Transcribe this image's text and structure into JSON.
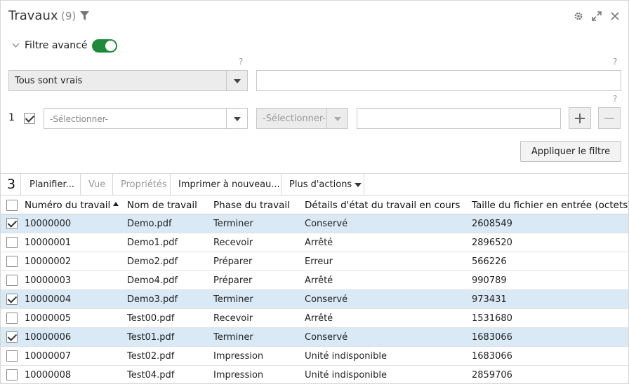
{
  "header": {
    "title": "Travaux",
    "count": "(9)"
  },
  "filter": {
    "advanced_label": "Filtre avancé",
    "advanced_enabled": true,
    "help": "?",
    "logic_select": "Tous sont vrais",
    "logic_value": "",
    "condition": {
      "row_number": "1",
      "checked": true,
      "field_placeholder": "-Sélectionner-",
      "operator_placeholder": "-Sélectionner-",
      "value": ""
    },
    "apply_label": "Appliquer le filtre"
  },
  "toolbar": {
    "selected_count": "3",
    "buttons": [
      {
        "label": "Planifier...",
        "enabled": true
      },
      {
        "label": "Vue",
        "enabled": false
      },
      {
        "label": "Propriétés",
        "enabled": false
      },
      {
        "label": "Imprimer à nouveau...",
        "enabled": true
      },
      {
        "label": "Plus d'actions",
        "enabled": true
      }
    ]
  },
  "table": {
    "columns": [
      "Numéro du travail",
      "Nom de travail",
      "Phase du travail",
      "Détails d'état du travail en cours",
      "Taille du fichier en entrée (octets)"
    ],
    "sort_column": 0,
    "rows": [
      {
        "selected": true,
        "cells": [
          "10000000",
          "Demo.pdf",
          "Terminer",
          "Conservé",
          "2608549"
        ]
      },
      {
        "selected": false,
        "cells": [
          "10000001",
          "Demo1.pdf",
          "Recevoir",
          "Arrêté",
          "2896520"
        ]
      },
      {
        "selected": false,
        "cells": [
          "10000002",
          "Demo2.pdf",
          "Préparer",
          "Erreur",
          "566226"
        ]
      },
      {
        "selected": false,
        "cells": [
          "10000003",
          "Demo4.pdf",
          "Préparer",
          "Arrêté",
          "990789"
        ]
      },
      {
        "selected": true,
        "cells": [
          "10000004",
          "Demo3.pdf",
          "Terminer",
          "Conservé",
          "973431"
        ]
      },
      {
        "selected": false,
        "cells": [
          "10000005",
          "Test00.pdf",
          "Recevoir",
          "Arrêté",
          "1531680"
        ]
      },
      {
        "selected": true,
        "cells": [
          "10000006",
          "Test01.pdf",
          "Terminer",
          "Conservé",
          "1683066"
        ]
      },
      {
        "selected": false,
        "cells": [
          "10000007",
          "Test02.pdf",
          "Impression",
          "Unité indisponible",
          "1683066"
        ]
      },
      {
        "selected": false,
        "cells": [
          "10000008",
          "Test04.pdf",
          "Impression",
          "Unité indisponible",
          "2859706"
        ]
      }
    ]
  },
  "colors": {
    "accent_toggle": "#1f8b3a",
    "row_selected": "#d9e9f5"
  },
  "icons": {
    "title_filter": "funnel-icon",
    "settings": "gear-icon",
    "expand": "expand-icon",
    "close": "close-icon",
    "add_condition": "plus-icon",
    "remove_condition": "minus-icon"
  }
}
